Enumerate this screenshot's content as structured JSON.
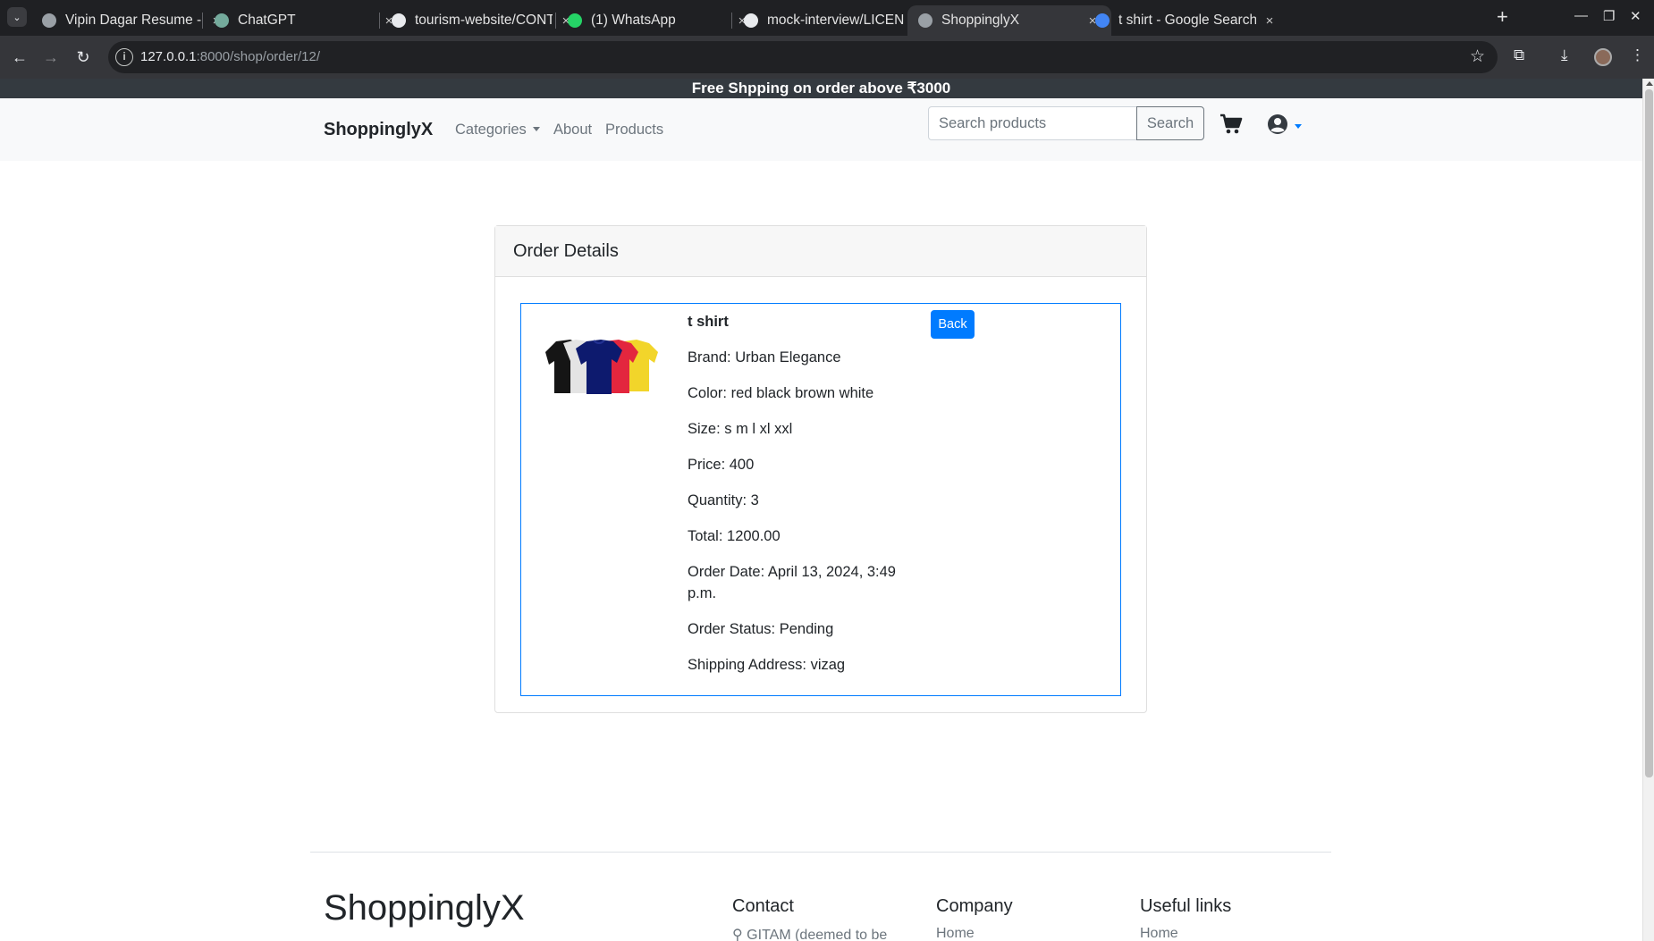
{
  "browser": {
    "tabs": [
      {
        "title": "Vipin Dagar Resume - G",
        "favicon_color": "#9aa0a6",
        "active": false
      },
      {
        "title": "ChatGPT",
        "favicon_color": "#74aa9c",
        "active": false
      },
      {
        "title": "tourism-website/CONTI",
        "favicon_color": "#e8eaed",
        "active": false
      },
      {
        "title": "(1) WhatsApp",
        "favicon_color": "#25d366",
        "active": false
      },
      {
        "title": "mock-interview/LICENS",
        "favicon_color": "#e8eaed",
        "active": false
      },
      {
        "title": "ShoppinglyX",
        "favicon_color": "#9aa0a6",
        "active": true
      },
      {
        "title": "t shirt - Google Search",
        "favicon_color": "#4285f4",
        "active": false
      }
    ],
    "tab_close_glyph": "×",
    "new_tab_glyph": "+",
    "address": {
      "host": "127.0.0.1",
      "path": ":8000/shop/order/12/"
    }
  },
  "promo": {
    "text": "Free Shpping on order above ₹3000"
  },
  "navbar": {
    "brand": "ShoppinglyX",
    "links": {
      "categories": "Categories",
      "about": "About",
      "products": "Products"
    },
    "search": {
      "placeholder": "Search products",
      "button": "Search"
    }
  },
  "order": {
    "header": "Order Details",
    "product_name": "t shirt",
    "brand": "Brand: Urban Elegance",
    "color": "Color: red black brown white",
    "size": "Size: s m l xl xxl",
    "price": "Price: 400",
    "quantity": "Quantity: 3",
    "total": "Total: 1200.00",
    "order_date": "Order Date: April 13, 2024, 3:49 p.m.",
    "status": "Order Status: Pending",
    "shipping": "Shipping Address: vizag",
    "back_button": "Back",
    "accent_color": "#007bff"
  },
  "footer": {
    "brand": "ShoppinglyX",
    "contact": {
      "heading": "Contact",
      "address_partial": "GITAM (deemed to be"
    },
    "company": {
      "heading": "Company",
      "first_link": "Home"
    },
    "useful_links": {
      "heading": "Useful links",
      "first_link": "Home"
    }
  }
}
